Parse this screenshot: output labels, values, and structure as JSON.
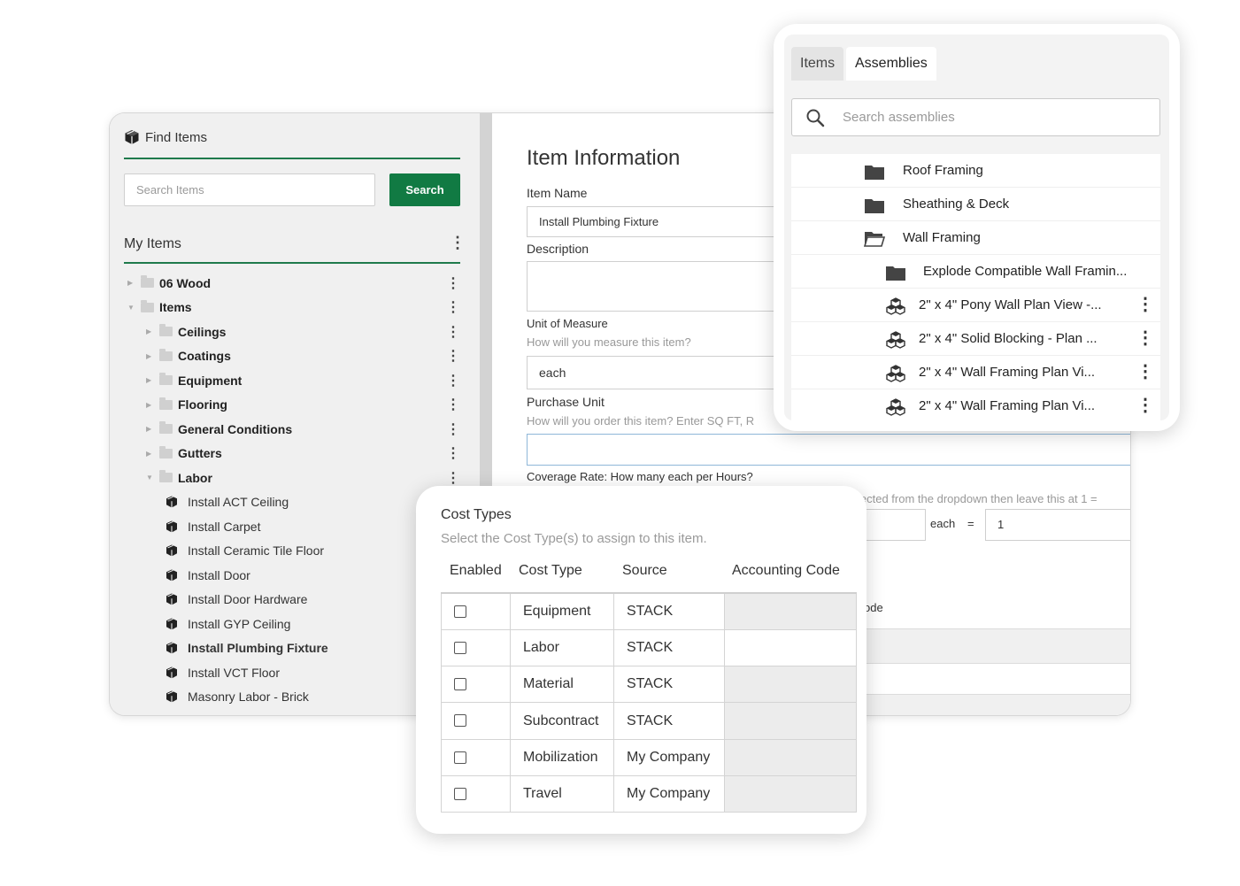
{
  "find_items": {
    "title": "Find Items",
    "search_placeholder": "Search Items",
    "search_button": "Search",
    "my_items_label": "My Items",
    "tree": [
      {
        "label": "06 Wood",
        "level": 0,
        "type": "folder",
        "expanded": false
      },
      {
        "label": "Items",
        "level": 0,
        "type": "folder",
        "expanded": true
      },
      {
        "label": "Ceilings",
        "level": 1,
        "type": "folder",
        "expanded": false
      },
      {
        "label": "Coatings",
        "level": 1,
        "type": "folder",
        "expanded": false
      },
      {
        "label": "Equipment",
        "level": 1,
        "type": "folder",
        "expanded": false
      },
      {
        "label": "Flooring",
        "level": 1,
        "type": "folder",
        "expanded": false
      },
      {
        "label": "General Conditions",
        "level": 1,
        "type": "folder",
        "expanded": false
      },
      {
        "label": "Gutters",
        "level": 1,
        "type": "folder",
        "expanded": false
      },
      {
        "label": "Labor",
        "level": 1,
        "type": "folder",
        "expanded": true
      },
      {
        "label": "Install ACT Ceiling",
        "level": 2,
        "type": "item"
      },
      {
        "label": "Install Carpet",
        "level": 2,
        "type": "item"
      },
      {
        "label": "Install Ceramic Tile Floor",
        "level": 2,
        "type": "item"
      },
      {
        "label": "Install Door",
        "level": 2,
        "type": "item"
      },
      {
        "label": "Install Door Hardware",
        "level": 2,
        "type": "item"
      },
      {
        "label": "Install GYP Ceiling",
        "level": 2,
        "type": "item"
      },
      {
        "label": "Install Plumbing Fixture",
        "level": 2,
        "type": "item",
        "selected": true
      },
      {
        "label": "Install VCT Floor",
        "level": 2,
        "type": "item"
      },
      {
        "label": "Masonry Labor - Brick",
        "level": 2,
        "type": "item"
      }
    ]
  },
  "item_info": {
    "title": "Item Information",
    "item_name_label": "Item Name",
    "item_name_value": "Install Plumbing Fixture",
    "description_label": "Description",
    "unit_label": "Unit of Measure",
    "unit_hint": "How will you measure this item?",
    "unit_value": "each",
    "purchase_label": "Purchase Unit",
    "purchase_hint": "How will you order this item? Enter SQ FT, R",
    "coverage_label": "Coverage Rate: How many each per Hours?",
    "coverage_hint": "lected from the dropdown then leave this at 1 =",
    "coverage_unit": "each",
    "coverage_equals": "=",
    "coverage_value": "1",
    "partial_code_label": "ode"
  },
  "assemblies": {
    "tabs": [
      "Items",
      "Assemblies"
    ],
    "active_tab": "Assemblies",
    "search_placeholder": "Search assemblies",
    "rows": [
      {
        "label": "Roof Framing",
        "icon": "folder-icon",
        "indent": 0
      },
      {
        "label": "Sheathing & Deck",
        "icon": "folder-icon",
        "indent": 0
      },
      {
        "label": "Wall Framing",
        "icon": "folder-open-icon",
        "indent": 0
      },
      {
        "label": "Explode Compatible Wall Framin...",
        "icon": "folder-icon",
        "indent": 1
      },
      {
        "label": "2\" x 4\" Pony Wall Plan View -...",
        "icon": "assembly-icon",
        "indent": 1,
        "menu": true
      },
      {
        "label": "2\" x 4\" Solid Blocking - Plan ...",
        "icon": "assembly-icon",
        "indent": 1,
        "menu": true
      },
      {
        "label": "2\" x 4\" Wall Framing Plan Vi...",
        "icon": "assembly-icon",
        "indent": 1,
        "menu": true
      },
      {
        "label": "2\" x 4\" Wall Framing Plan Vi...",
        "icon": "assembly-icon",
        "indent": 1,
        "menu": true
      }
    ]
  },
  "cost_types": {
    "title": "Cost Types",
    "subtitle": "Select the Cost Type(s) to assign to this item.",
    "headers": [
      "Enabled",
      "Cost Type",
      "Source",
      "Accounting Code"
    ],
    "rows": [
      {
        "cost_type": "Equipment",
        "source": "STACK",
        "enabled": false
      },
      {
        "cost_type": "Labor",
        "source": "STACK",
        "enabled": false
      },
      {
        "cost_type": "Material",
        "source": "STACK",
        "enabled": false
      },
      {
        "cost_type": "Subcontract",
        "source": "STACK",
        "enabled": false
      },
      {
        "cost_type": "Mobilization",
        "source": "My Company",
        "enabled": false
      },
      {
        "cost_type": "Travel",
        "source": "My Company",
        "enabled": false
      }
    ]
  },
  "colors": {
    "accent_green": "#117a43",
    "divider_green": "#1f7a4c"
  }
}
